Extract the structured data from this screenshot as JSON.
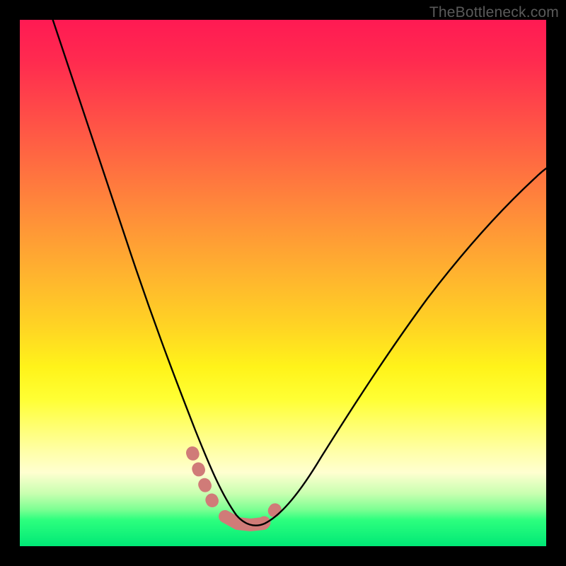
{
  "watermark": "TheBottleneck.com",
  "colors": {
    "frame": "#000000",
    "curve": "#000000",
    "accent_underlay": "#d07b78",
    "gradient_top": "#ff1a53",
    "gradient_bottom": "#00e876"
  },
  "chart_data": {
    "type": "line",
    "title": "",
    "xlabel": "",
    "ylabel": "",
    "xlim": [
      0,
      100
    ],
    "ylim": [
      0,
      100
    ],
    "grid": false,
    "legend": false,
    "series": [
      {
        "name": "bottleneck-curve",
        "x": [
          5,
          8,
          12,
          16,
          20,
          24,
          28,
          31,
          34,
          36,
          38,
          40,
          42,
          44,
          46,
          48,
          52,
          56,
          60,
          66,
          72,
          78,
          84,
          90,
          96,
          100
        ],
        "y": [
          101,
          92,
          80,
          68,
          56,
          44,
          32,
          23,
          15,
          10,
          6,
          4,
          3,
          3,
          3,
          4,
          7,
          12,
          18,
          27,
          36,
          45,
          53,
          60,
          66,
          70
        ]
      }
    ],
    "annotations": [
      {
        "name": "accent-near-minimum",
        "style": "thick-dotted",
        "x": [
          34,
          36,
          38,
          40,
          42,
          44,
          46,
          48
        ],
        "y": [
          15,
          10,
          6,
          4,
          3,
          3,
          3,
          4
        ]
      }
    ]
  }
}
